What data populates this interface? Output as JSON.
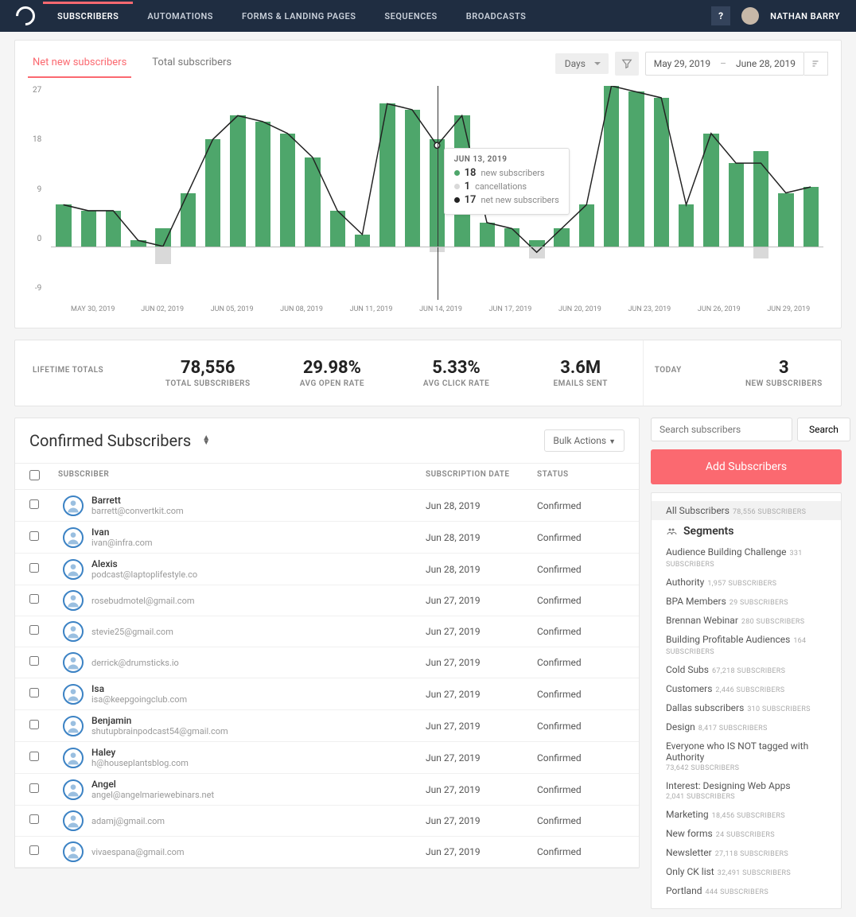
{
  "nav": {
    "items": [
      "SUBSCRIBERS",
      "AUTOMATIONS",
      "FORMS & LANDING PAGES",
      "SEQUENCES",
      "BROADCASTS"
    ],
    "active": 0
  },
  "user": {
    "name": "NATHAN BARRY",
    "help": "?"
  },
  "chart_tabs": {
    "net": "Net new subscribers",
    "total": "Total subscribers"
  },
  "controls": {
    "granularity": "Days",
    "date_from": "May 29, 2019",
    "date_to": "June 28, 2019"
  },
  "chart_data": {
    "type": "bar",
    "y_ticks": [
      27,
      18,
      9,
      0,
      -9
    ],
    "x_ticks": [
      "MAY 30, 2019",
      "JUN 02, 2019",
      "JUN 05, 2019",
      "JUN 08, 2019",
      "JUN 11, 2019",
      "JUN 14, 2019",
      "JUN 17, 2019",
      "JUN 20, 2019",
      "JUN 23, 2019",
      "JUN 26, 2019",
      "JUN 29, 2019"
    ],
    "categories": [
      "2019-05-29",
      "2019-05-30",
      "2019-05-31",
      "2019-06-01",
      "2019-06-02",
      "2019-06-03",
      "2019-06-04",
      "2019-06-05",
      "2019-06-06",
      "2019-06-07",
      "2019-06-08",
      "2019-06-09",
      "2019-06-10",
      "2019-06-11",
      "2019-06-12",
      "2019-06-13",
      "2019-06-14",
      "2019-06-15",
      "2019-06-16",
      "2019-06-17",
      "2019-06-18",
      "2019-06-19",
      "2019-06-20",
      "2019-06-21",
      "2019-06-22",
      "2019-06-23",
      "2019-06-24",
      "2019-06-25",
      "2019-06-26",
      "2019-06-27",
      "2019-06-28"
    ],
    "series": [
      {
        "name": "new subscribers",
        "values": [
          7,
          6,
          6,
          1,
          3,
          9,
          18,
          22,
          21,
          19,
          15,
          6,
          2,
          24,
          23,
          18,
          22,
          4,
          3,
          1,
          3,
          7,
          27,
          26,
          25,
          7,
          19,
          14,
          16,
          9,
          10
        ]
      },
      {
        "name": "cancellations",
        "values": [
          0,
          0,
          0,
          0,
          3,
          0,
          0,
          0,
          0,
          0,
          0,
          0,
          0,
          0,
          0,
          1,
          0,
          0,
          0,
          2,
          0,
          0,
          0,
          0,
          0,
          0,
          0,
          0,
          2,
          0,
          0
        ]
      },
      {
        "name": "net new subscribers",
        "values": [
          7,
          6,
          6,
          1,
          0,
          9,
          18,
          22,
          21,
          19,
          15,
          6,
          2,
          24,
          23,
          17,
          22,
          4,
          3,
          -1,
          3,
          7,
          27,
          26,
          25,
          7,
          19,
          14,
          14,
          9,
          10
        ]
      }
    ],
    "ylim": [
      -9,
      27
    ],
    "tooltip": {
      "date": "JUN 13, 2019",
      "new": 18,
      "new_label": "new subscribers",
      "cancel": 1,
      "cancel_label": "cancellations",
      "net": 17,
      "net_label": "net new subscribers"
    }
  },
  "stats": {
    "lifetime_label": "LIFETIME TOTALS",
    "items": [
      {
        "value": "78,556",
        "label": "TOTAL SUBSCRIBERS"
      },
      {
        "value": "29.98%",
        "label": "AVG OPEN RATE"
      },
      {
        "value": "5.33%",
        "label": "AVG CLICK RATE"
      },
      {
        "value": "3.6M",
        "label": "EMAILS SENT"
      }
    ],
    "today_label": "TODAY",
    "today_value": "3",
    "today_sub": "NEW SUBSCRIBERS"
  },
  "table": {
    "title": "Confirmed Subscribers",
    "bulk": "Bulk Actions",
    "headers": {
      "sub": "SUBSCRIBER",
      "date": "SUBSCRIPTION DATE",
      "status": "STATUS"
    },
    "rows": [
      {
        "name": "Barrett",
        "email": "barrett@convertkit.com",
        "date": "Jun 28, 2019",
        "status": "Confirmed"
      },
      {
        "name": "Ivan",
        "email": "ivan@infra.com",
        "date": "Jun 28, 2019",
        "status": "Confirmed"
      },
      {
        "name": "Alexis",
        "email": "podcast@laptoplifestyle.co",
        "date": "Jun 28, 2019",
        "status": "Confirmed"
      },
      {
        "name": "",
        "email": "rosebudmotel@gmail.com",
        "date": "Jun 27, 2019",
        "status": "Confirmed"
      },
      {
        "name": "",
        "email": "stevie25@gmail.com",
        "date": "Jun 27, 2019",
        "status": "Confirmed"
      },
      {
        "name": "",
        "email": "derrick@drumsticks.io",
        "date": "Jun 27, 2019",
        "status": "Confirmed"
      },
      {
        "name": "Isa",
        "email": "isa@keepgoingclub.com",
        "date": "Jun 27, 2019",
        "status": "Confirmed"
      },
      {
        "name": "Benjamin",
        "email": "shutupbrainpodcast54@gmail.com",
        "date": "Jun 27, 2019",
        "status": "Confirmed"
      },
      {
        "name": "Haley",
        "email": "h@houseplantsblog.com",
        "date": "Jun 27, 2019",
        "status": "Confirmed"
      },
      {
        "name": "Angel",
        "email": "angel@angelmariewebinars.net",
        "date": "Jun 27, 2019",
        "status": "Confirmed"
      },
      {
        "name": "",
        "email": "adamj@gmail.com",
        "date": "Jun 27, 2019",
        "status": "Confirmed"
      },
      {
        "name": "",
        "email": "vivaespana@gmail.com",
        "date": "Jun 27, 2019",
        "status": "Confirmed"
      }
    ]
  },
  "side": {
    "search_ph": "Search subscribers",
    "search_btn": "Search",
    "add": "Add Subscribers",
    "all": {
      "label": "All Subscribers",
      "count": "78,556 SUBSCRIBERS"
    },
    "segments_label": "Segments",
    "segments": [
      {
        "label": "Audience Building Challenge",
        "count": "331 SUBSCRIBERS"
      },
      {
        "label": "Authority",
        "count": "1,957 SUBSCRIBERS"
      },
      {
        "label": "BPA Members",
        "count": "29 SUBSCRIBERS"
      },
      {
        "label": "Brennan Webinar",
        "count": "280 SUBSCRIBERS"
      },
      {
        "label": "Building Profitable Audiences",
        "count": "164 SUBSCRIBERS"
      },
      {
        "label": "Cold Subs",
        "count": "67,218 SUBSCRIBERS"
      },
      {
        "label": "Customers",
        "count": "2,446 SUBSCRIBERS"
      },
      {
        "label": "Dallas subscribers",
        "count": "310 SUBSCRIBERS"
      },
      {
        "label": "Design",
        "count": "8,417 SUBSCRIBERS"
      },
      {
        "label": "Everyone who IS NOT tagged with Authority",
        "count": "73,642 SUBSCRIBERS",
        "multiline": true
      },
      {
        "label": "Interest: Designing Web Apps",
        "count": "2,041 SUBSCRIBERS",
        "multiline": true
      },
      {
        "label": "Marketing",
        "count": "18,456 SUBSCRIBERS"
      },
      {
        "label": "New forms",
        "count": "24 SUBSCRIBERS"
      },
      {
        "label": "Newsletter",
        "count": "27,118 SUBSCRIBERS"
      },
      {
        "label": "Only CK list",
        "count": "32,491 SUBSCRIBERS"
      },
      {
        "label": "Portland",
        "count": "444 SUBSCRIBERS"
      }
    ]
  }
}
